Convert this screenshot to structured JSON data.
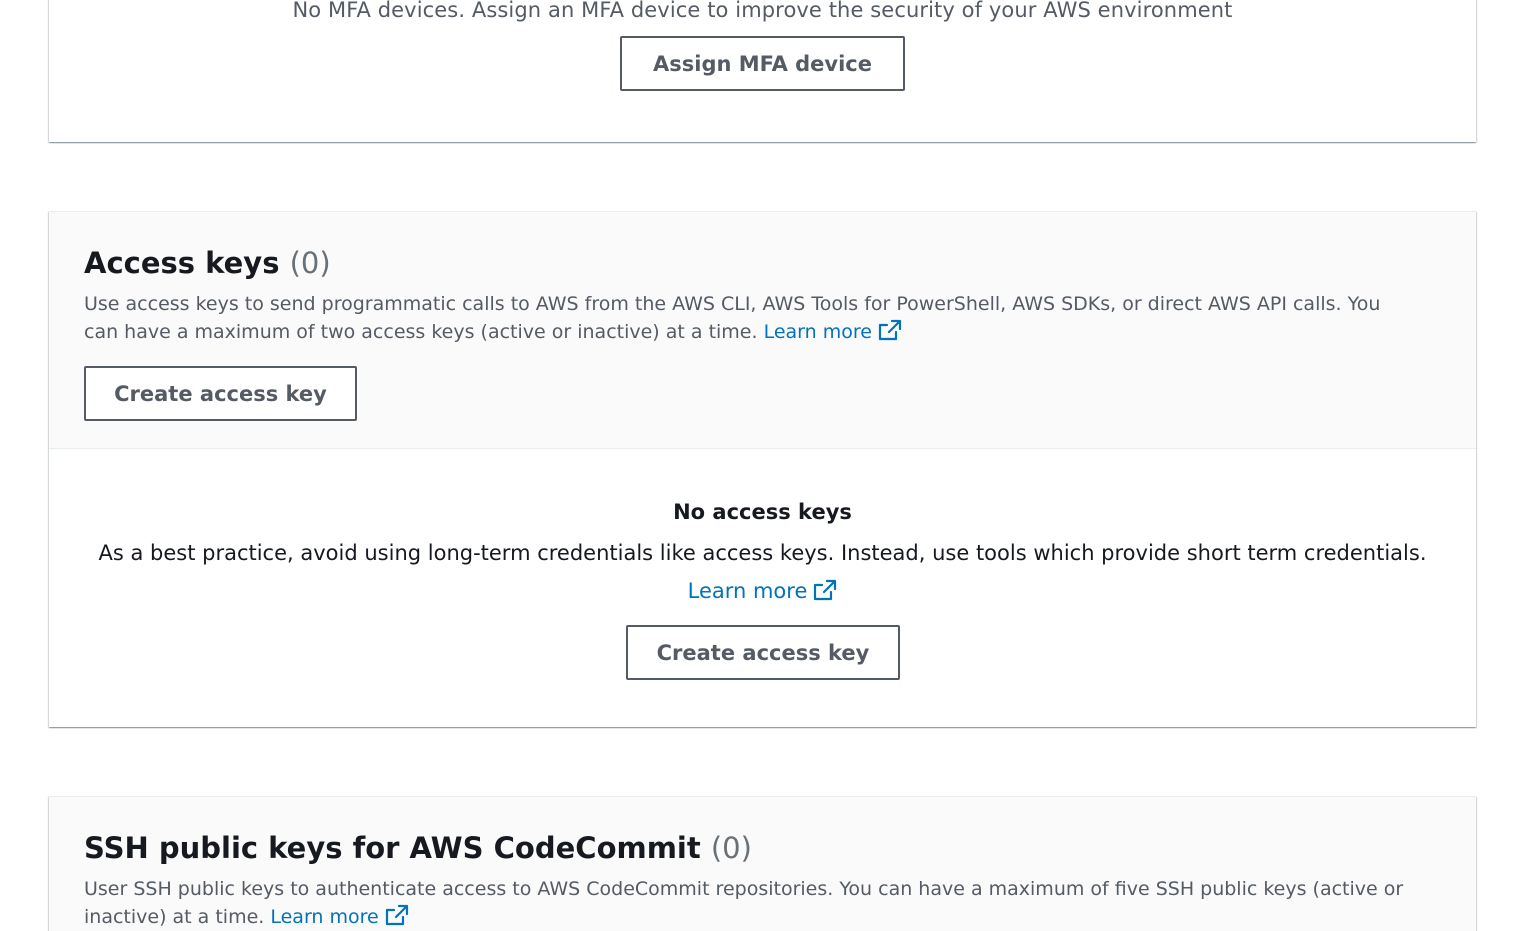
{
  "mfa": {
    "empty_text": "No MFA devices. Assign an MFA device to improve the security of your AWS environment",
    "assign_button": "Assign MFA device"
  },
  "access_keys": {
    "title": "Access keys",
    "count": "(0)",
    "description": "Use access keys to send programmatic calls to AWS from the AWS CLI, AWS Tools for PowerShell, AWS SDKs, or direct AWS API calls. You can have a maximum of two access keys (active or inactive) at a time.",
    "learn_more": "Learn more",
    "create_button": "Create access key",
    "empty_title": "No access keys",
    "empty_description": "As a best practice, avoid using long-term credentials like access keys. Instead, use tools which provide short term credentials.",
    "empty_learn_more": "Learn more",
    "empty_create_button": "Create access key"
  },
  "ssh_keys": {
    "title": "SSH public keys for AWS CodeCommit",
    "count": "(0)",
    "description": "User SSH public keys to authenticate access to AWS CodeCommit repositories. You can have a maximum of five SSH public keys (active or inactive) at a time.",
    "learn_more": "Learn more"
  },
  "icons": {
    "external_link": "external-link-icon"
  },
  "colors": {
    "link": "#0073bb",
    "button_border": "#545b64",
    "header_bg": "#fafafa",
    "count_gray": "#687078"
  }
}
